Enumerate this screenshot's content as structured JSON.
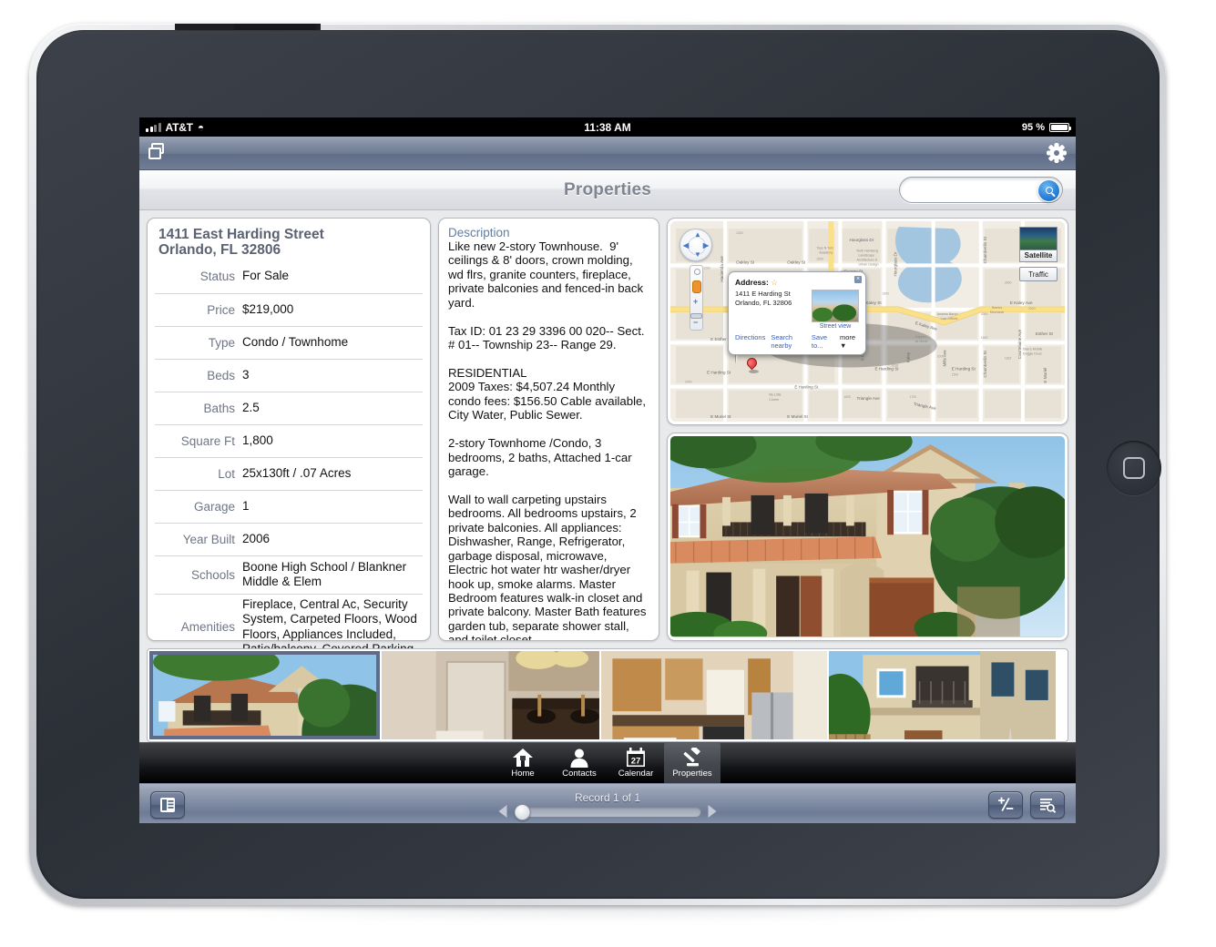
{
  "status_bar": {
    "carrier": "AT&T",
    "time": "11:38 AM",
    "battery": "95 %",
    "signal_icon": "signal-bars-icon",
    "wifi_icon": "wifi-icon"
  },
  "app_toolbar": {
    "window_icon": "windows-stack-icon",
    "settings_icon": "gear-icon"
  },
  "nav_bar": {
    "title": "Properties",
    "search_value": "",
    "search_placeholder": "",
    "search_icon": "search-icon"
  },
  "property": {
    "address_line1": "1411 East Harding Street",
    "address_line2": "Orlando, FL 32806",
    "fields": [
      {
        "label": "Status",
        "value": "For Sale"
      },
      {
        "label": "Price",
        "value": "$219,000"
      },
      {
        "label": "Type",
        "value": "Condo / Townhome"
      },
      {
        "label": "Beds",
        "value": "3"
      },
      {
        "label": "Baths",
        "value": "2.5"
      },
      {
        "label": "Square Ft",
        "value": "1,800"
      },
      {
        "label": "Lot",
        "value": "25x130ft / .07 Acres"
      },
      {
        "label": "Garage",
        "value": "1"
      },
      {
        "label": "Year Built",
        "value": "2006"
      },
      {
        "label": "Schools",
        "value": "Boone High School / Blankner Middle & Elem"
      },
      {
        "label": "Amenities",
        "value": "Fireplace, Central Ac, Security System, Carpeted Floors, Wood Floors, Appliances Included, Patio/balcony, Covered Parking"
      }
    ]
  },
  "description": {
    "title": "Description",
    "body": "Like new 2-story Townhouse.  9' ceilings & 8' doors, crown molding, wd flrs, granite counters, fireplace, private balconies and fenced-in back yard.\n\nTax ID: 01 23 29 3396 00 020-- Sect. # 01-- Township 23-- Range 29.\n\nRESIDENTIAL\n2009 Taxes: $4,507.24 Monthly condo fees: $156.50 Cable available, City Water, Public Sewer.\n\n2-story Townhome /Condo, 3 bedrooms, 2 baths, Attached 1-car garage.\n\nWall to wall carpeting upstairs bedrooms. All bedrooms upstairs, 2 private balconies. All appliances: Dishwasher, Range, Refrigerator, garbage disposal, microwave, Electric hot water htr washer/dryer hook up, smoke alarms. Master Bedroom features walk-in closet and private balcony. Master Bath features garden tub, separate shower stall, and toilet closet."
  },
  "map": {
    "satellite_label": "Satellite",
    "traffic_label": "Traffic",
    "pan_control_icon": "pan-control-icon",
    "zoom_control_icon": "zoom-slider-icon",
    "pin_icon": "map-pin-icon",
    "bubble": {
      "heading": "Address:",
      "star_icon": "star-icon",
      "close_icon": "close-icon",
      "address_line1": "1411 E Harding St",
      "address_line2": "Orlando, FL 32806",
      "street_view_label": "Street view",
      "links": [
        "Directions",
        "Search nearby",
        "Save to...",
        "more"
      ]
    },
    "street_labels": [
      "Hourglass Dr",
      "Oakley St",
      "Oakley St",
      "George St",
      "E Kaley Ave",
      "E Kaley Ave",
      "E Esther St",
      "Esther St",
      "E Harding St",
      "E Harding St",
      "E Harding St",
      "E Harding St",
      "E Muriel St",
      "E Muriel St",
      "Triangle Ave",
      "Triangle Ave",
      "Hacienda Ave",
      "Hourglass Dr",
      "Chamberlin St",
      "Chamberlin St",
      "Courtelaine Ave",
      "S Ferncreek",
      "Mills Ave",
      "Kaley St",
      "E Muriel St"
    ],
    "poi_labels": [
      "Toys N Tots Academy",
      "Ruth Hamberg Landscape Architecture & Urban Design",
      "Andrew Baron Law Offices",
      "Ramirs Mechanic",
      "Dian's Mobile Doggie Doos",
      "Happen At Home",
      "My Little Corner"
    ]
  },
  "thumbnails": [
    {
      "name": "exterior-front",
      "selected": true
    },
    {
      "name": "master-bathroom",
      "selected": false
    },
    {
      "name": "kitchen",
      "selected": false
    },
    {
      "name": "exterior-rear",
      "selected": false
    }
  ],
  "main_photo": {
    "name": "property-exterior-front-large"
  },
  "tab_bar": {
    "tabs": [
      {
        "label": "Home",
        "icon": "home-icon",
        "active": false
      },
      {
        "label": "Contacts",
        "icon": "person-icon",
        "active": false
      },
      {
        "label": "Calendar",
        "icon": "calendar-icon",
        "active": false,
        "day": "27"
      },
      {
        "label": "Properties",
        "icon": "gavel-icon",
        "active": true
      }
    ]
  },
  "record_bar": {
    "list_view_icon": "list-view-icon",
    "record_label": "Record 1 of 1",
    "prev_icon": "arrow-left-icon",
    "next_icon": "arrow-right-icon",
    "add_delete_icon": "plus-minus-icon",
    "find_icon": "find-records-icon"
  },
  "device": {
    "home_button_icon": "home-button-icon"
  },
  "colors": {
    "toolbar_blue": "#6d7a92",
    "title_gray": "#7f8591",
    "label_blue": "#6f7686",
    "desc_title_blue": "#5d7fa8",
    "accent_blue": "#2b82d9",
    "thumb_selected": "#5f6b8a",
    "map_road_yellow": "#fbe08a",
    "map_water": "#9fc4e0",
    "map_land": "#f2ede4"
  }
}
